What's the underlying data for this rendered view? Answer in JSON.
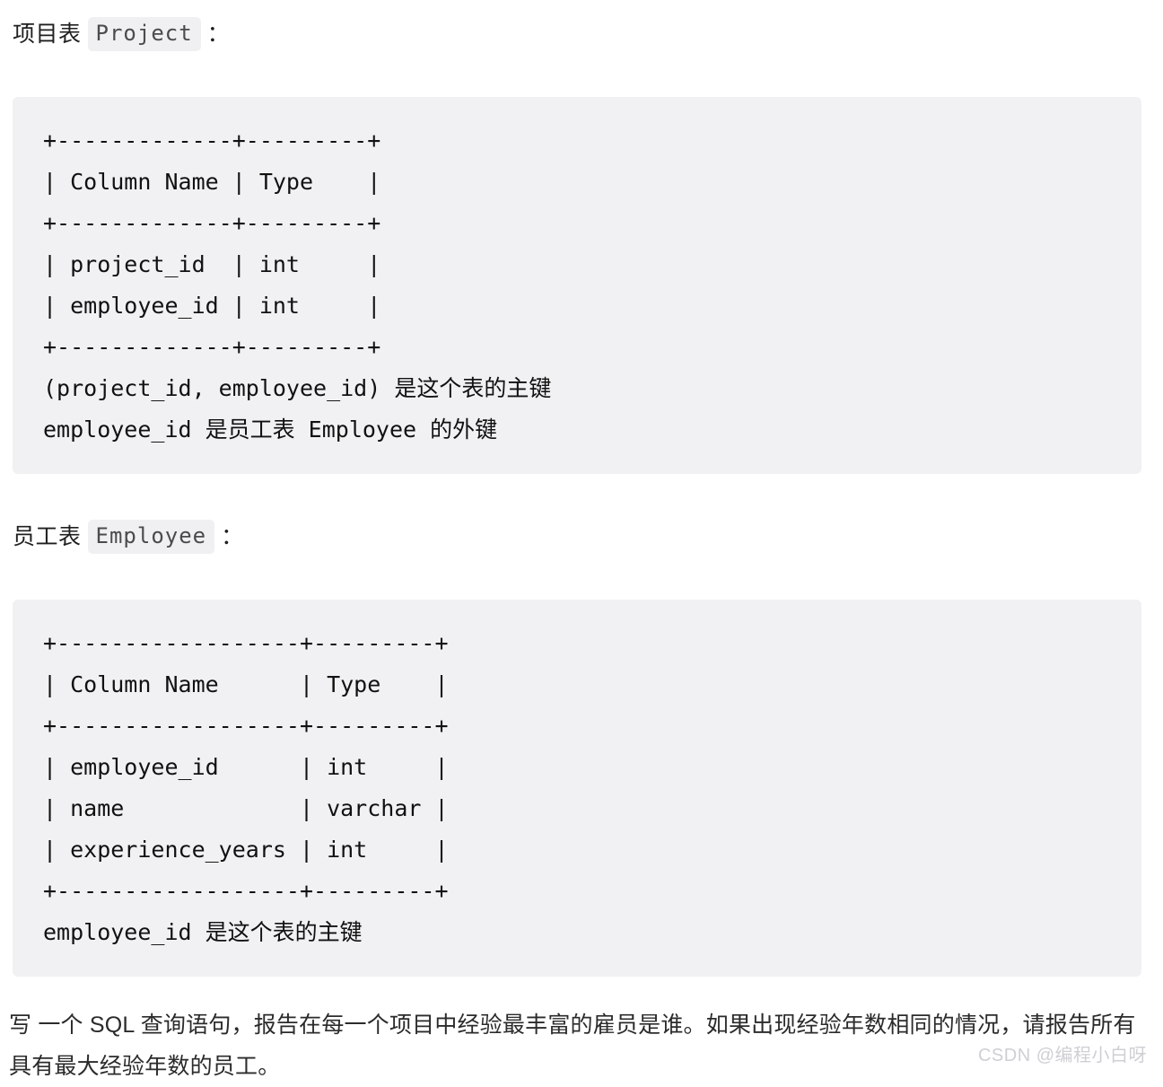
{
  "document": {
    "sections": [
      {
        "heading_prefix": "项目表",
        "heading_code": "Project",
        "heading_colon": "：",
        "code_lines": [
          "+-------------+---------+",
          "| Column Name | Type    |",
          "+-------------+---------+",
          "| project_id  | int     |",
          "| employee_id | int     |",
          "+-------------+---------+",
          "(project_id, employee_id) 是这个表的主键",
          "employee_id 是员工表 Employee 的外键"
        ]
      },
      {
        "heading_prefix": "员工表",
        "heading_code": "Employee",
        "heading_colon": "：",
        "code_lines": [
          "+------------------+---------+",
          "| Column Name      | Type    |",
          "+------------------+---------+",
          "| employee_id      | int     |",
          "| name             | varchar |",
          "| experience_years | int     |",
          "+------------------+---------+",
          "employee_id 是这个表的主键"
        ]
      }
    ],
    "prose": "写 一个 SQL 查询语句，报告在每一个项目中经验最丰富的雇员是谁。如果出现经验年数相同的情况，请报告所有具有最大经验年数的员工。",
    "watermark": "CSDN @编程小白呀"
  },
  "colors": {
    "code_block_background": "#f1f1f3",
    "inline_code_background": "#f0f0f2",
    "inline_code_text": "#4b4b4b",
    "body_text": "#1f1f1f",
    "watermark_text": "#cfcfd4",
    "page_background": "#ffffff"
  }
}
